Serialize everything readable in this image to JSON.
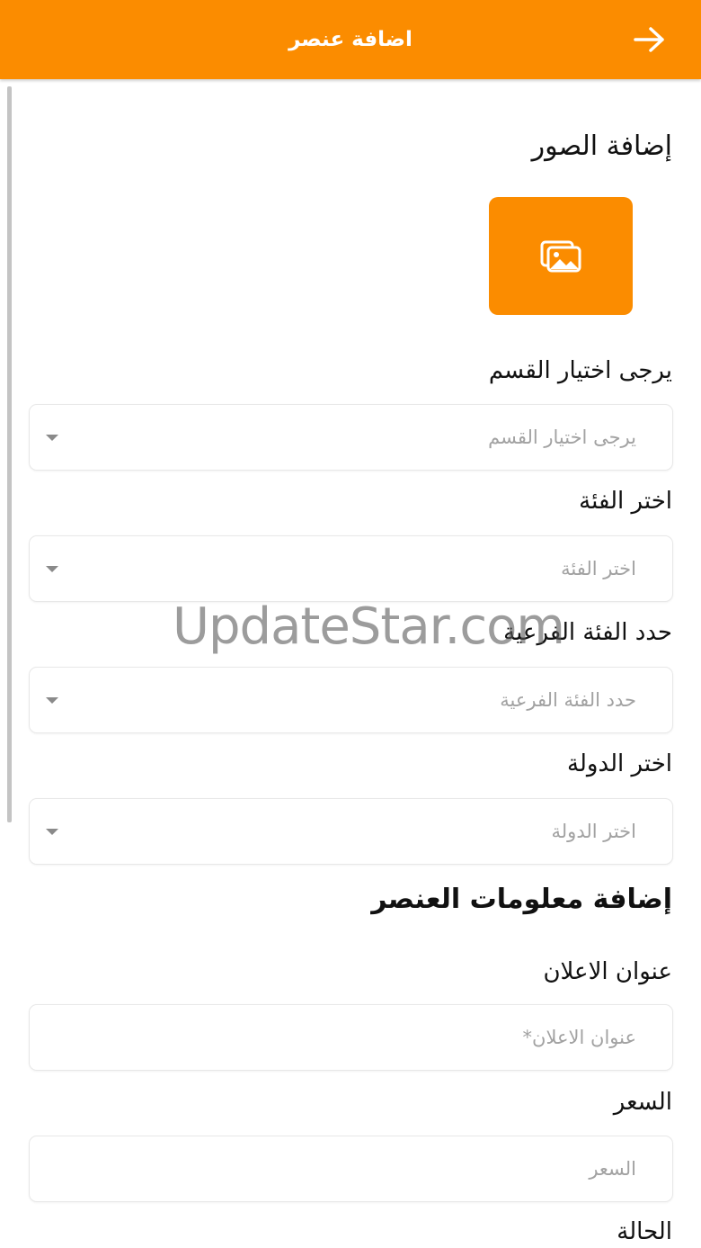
{
  "appbar": {
    "title": "اضافة عنصر",
    "back_icon": "arrow-right-icon",
    "color": "#fb8c00"
  },
  "photos": {
    "title": "إضافة الصور",
    "button_icon": "image-gallery-icon"
  },
  "selects": [
    {
      "label": "يرجى اختيار القسم",
      "placeholder": "يرجى اختيار القسم"
    },
    {
      "label": "اختر الفئة",
      "placeholder": "اختر الفئة"
    },
    {
      "label": "حدد الفئة الفرعية",
      "placeholder": "حدد الفئة الفرعية"
    },
    {
      "label": "اختر الدولة",
      "placeholder": "اختر الدولة"
    }
  ],
  "item_info": {
    "title": "إضافة معلومات العنصر",
    "fields": [
      {
        "label": "عنوان الاعلان",
        "placeholder": "عنوان الاعلان*"
      },
      {
        "label": "السعر",
        "placeholder": "السعر"
      }
    ],
    "status_label": "الحالة"
  },
  "watermark": "UpdateStar.com"
}
